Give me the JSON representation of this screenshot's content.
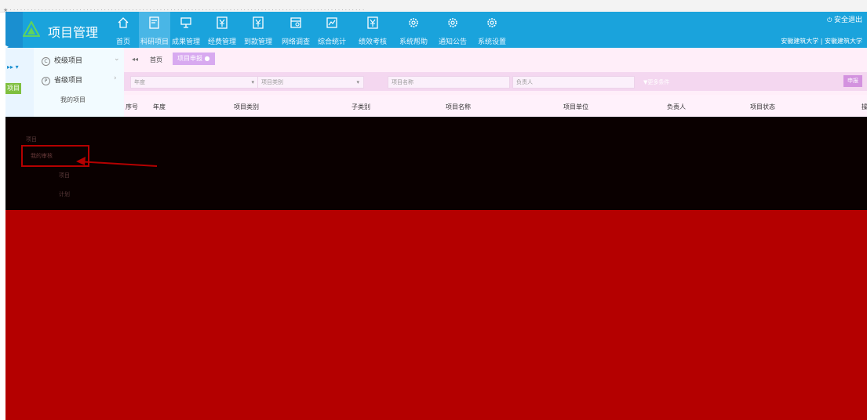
{
  "app": {
    "title": "项目管理"
  },
  "nav": [
    {
      "label": "首页",
      "icon": "home-icon"
    },
    {
      "label": "科研项目",
      "icon": "project-doc-icon"
    },
    {
      "label": "成果管理",
      "icon": "presentation-icon"
    },
    {
      "label": "经费管理",
      "icon": "yuan-doc-icon"
    },
    {
      "label": "到款管理",
      "icon": "yuan-doc-icon"
    },
    {
      "label": "网络调查",
      "icon": "survey-icon"
    },
    {
      "label": "综合统计",
      "icon": "chart-icon"
    },
    {
      "label": "绩效考核",
      "icon": "yuan-doc-icon"
    },
    {
      "label": "系统帮助",
      "icon": "gear-icon"
    },
    {
      "label": "通知公告",
      "icon": "gear-icon"
    },
    {
      "label": "系统设置",
      "icon": "gear-icon"
    }
  ],
  "topbar_right": {
    "logout": "安全退出",
    "user": "安徽建筑大学 | 安徽建筑大学"
  },
  "sidebar": {
    "items": [
      {
        "label": "校级项目",
        "badge": "C"
      },
      {
        "label": "省级项目",
        "badge": "P"
      }
    ],
    "sub_item": "我的项目",
    "strip_label": "项目"
  },
  "tabs": {
    "home": "首页",
    "current": "项目申报"
  },
  "filters": {
    "year": "年度",
    "category": "项目类别",
    "name": "项目名称",
    "leader": "负责人",
    "more": "更多条件",
    "submit": "申报"
  },
  "table_headers": [
    "序号",
    "年度",
    "项目类别",
    "子类别",
    "项目名称",
    "项目单位",
    "负责人",
    "项目状态",
    "操"
  ],
  "overlay": {
    "highlighted": "我的审核",
    "items": [
      "项目",
      "计划"
    ]
  },
  "colors": {
    "header": "#1aa3dc",
    "overlay": "#0a0000",
    "red": "#b40000"
  }
}
